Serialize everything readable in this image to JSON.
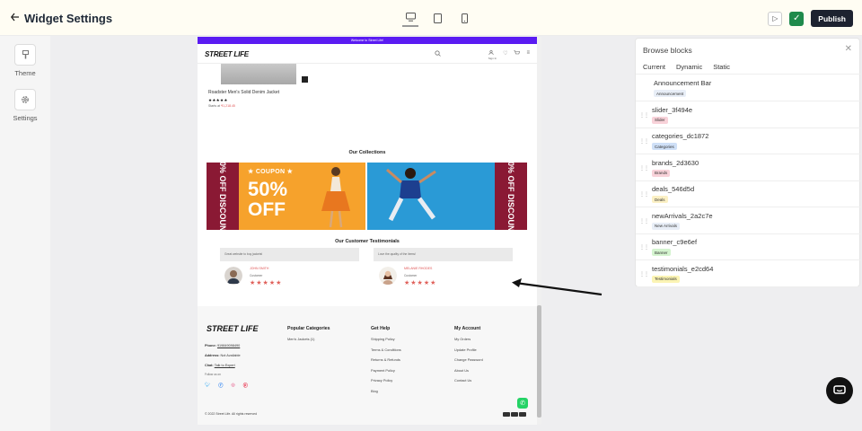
{
  "header": {
    "back_icon": "arrow-left-icon",
    "title": "Widget Settings",
    "devices": [
      "desktop",
      "tablet",
      "mobile"
    ],
    "active_device": "desktop",
    "publish_label": "Publish"
  },
  "rail": {
    "items": [
      {
        "label": "Theme",
        "icon": "brush-icon"
      },
      {
        "label": "Settings",
        "icon": "gear-icon"
      }
    ]
  },
  "preview": {
    "announcement": "Welcome to Street Life!",
    "logo": "STREET LIFE",
    "signin": "Sign In",
    "product": {
      "name": "Roadster Men's Solid Denim Jacket",
      "stars": "★★★★★",
      "price_prefix": "Starts at",
      "price": "₹1,218.45"
    },
    "collections_title": "Our Collections",
    "banner1": {
      "ticket_text": "50% OFF DISCOUNT",
      "coupon": "★ COUPON ★",
      "big_pct": "50%",
      "big_off": "OFF"
    },
    "banner2": {
      "ticket_text": "50% OFF DISCOUNT"
    },
    "testimonials_title": "Our Customer Testimonials",
    "testimonials": [
      {
        "quote": "Great website to buy jackets!",
        "name": "JOHN SMITH",
        "role": "Customer",
        "stars": "★★★★★"
      },
      {
        "quote": "Love the quality of the items!",
        "name": "MELANIE RHODES",
        "role": "Customer",
        "stars": "★★★★★"
      }
    ],
    "footer": {
      "logo": "STREET LIFE",
      "phone_label": "Phone:",
      "phone": "919849098490",
      "address_label": "Address:",
      "address": "Not Available",
      "chat_label": "Chat:",
      "chat": "Talk to Expert",
      "follow": "Follow us on",
      "columns": [
        {
          "title": "Popular Categories",
          "links": [
            "Men's Jackets (1)"
          ]
        },
        {
          "title": "Get Help",
          "links": [
            "Shipping Policy",
            "Terms & Conditions",
            "Returns & Refunds",
            "Payment Policy",
            "Privacy Policy",
            "Blog"
          ]
        },
        {
          "title": "My Account",
          "links": [
            "My Orders",
            "Update Profile",
            "Change Password",
            "About Us",
            "Contact Us"
          ]
        }
      ],
      "copyright": "© 2022 Street Life. All rights reserved"
    }
  },
  "panel": {
    "title": "Browse blocks",
    "tabs": [
      "Current",
      "Dynamic",
      "Static"
    ],
    "blocks": [
      {
        "name": "Announcement Bar",
        "tag": "Announcement",
        "color": "#e8eef7"
      },
      {
        "name": "slider_3f494e",
        "tag": "Slider",
        "color": "#f8d2d9"
      },
      {
        "name": "categories_dc1872",
        "tag": "Categories",
        "color": "#cfe0f7"
      },
      {
        "name": "brands_2d3630",
        "tag": "Brands",
        "color": "#f8d2d9"
      },
      {
        "name": "deals_546d5d",
        "tag": "Deals",
        "color": "#fbf0c4"
      },
      {
        "name": "newArrivals_2a2c7e",
        "tag": "New Arrivals",
        "color": "#e8eef7"
      },
      {
        "name": "banner_c9e6ef",
        "tag": "Banner",
        "color": "#d4f4cf"
      },
      {
        "name": "testimonials_e2cd64",
        "tag": "Testimonials",
        "color": "#fbf4b4"
      }
    ]
  }
}
